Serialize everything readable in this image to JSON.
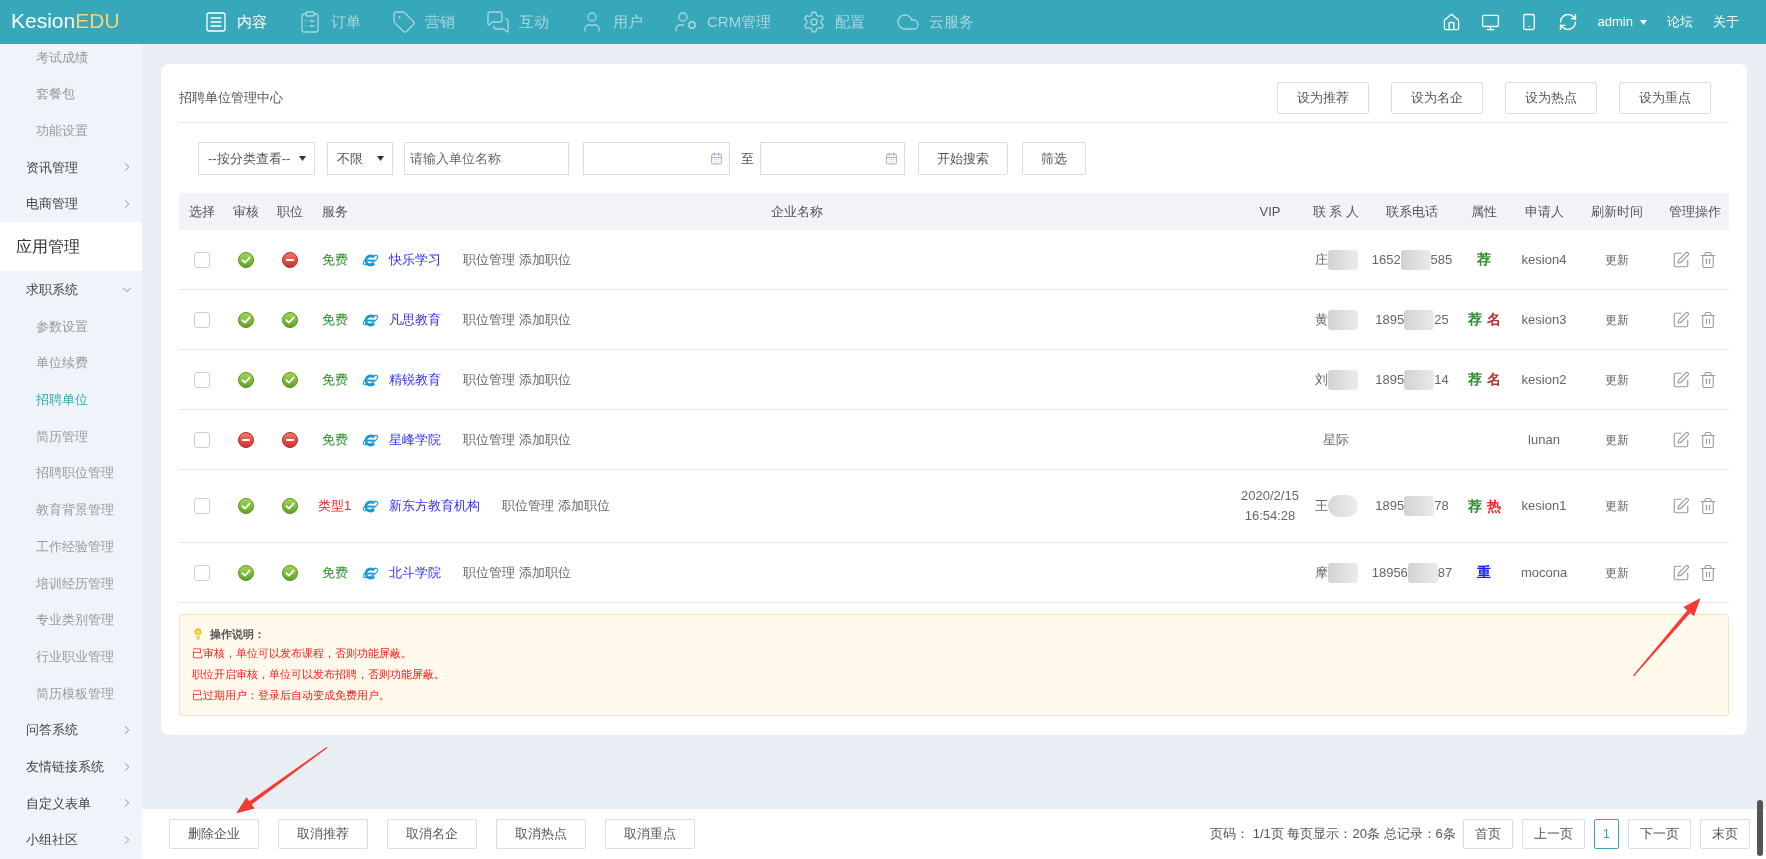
{
  "top_bar": {
    "logo": {
      "part_1": "Kesion",
      "part_2": "EDU"
    },
    "nav": [
      {
        "label": "内容",
        "selected": true
      },
      {
        "label": "订单",
        "selected": false
      },
      {
        "label": "营销",
        "selected": false
      },
      {
        "label": "互动",
        "selected": false
      },
      {
        "label": "用户",
        "selected": false
      },
      {
        "label": "CRM管理",
        "selected": false
      },
      {
        "label": "配置",
        "selected": false
      },
      {
        "label": "云服务",
        "selected": false
      }
    ],
    "user": "admin",
    "links": [
      "论坛",
      "关于"
    ]
  },
  "sidebar": {
    "sections": [
      {
        "items": [
          {
            "children": [
              {
                "label": "考试成绩",
                "selected": false
              },
              {
                "label": "套餐包",
                "selected": false
              },
              {
                "label": "功能设置",
                "selected": false
              }
            ]
          },
          {
            "label": "资讯管理",
            "expanded": false
          },
          {
            "label": "电商管理",
            "expanded": false
          }
        ]
      },
      {
        "title": "应用管理",
        "items": [
          {
            "label": "求职系统",
            "expanded": true,
            "children": [
              {
                "label": "参数设置",
                "selected": false
              },
              {
                "label": "单位续费",
                "selected": false
              },
              {
                "label": "招聘单位",
                "selected": true
              },
              {
                "label": "简历管理",
                "selected": false
              },
              {
                "label": "招聘职位管理",
                "selected": false
              },
              {
                "label": "教育背景管理",
                "selected": false
              },
              {
                "label": "工作经验管理",
                "selected": false
              },
              {
                "label": "培训经历管理",
                "selected": false
              },
              {
                "label": "专业类别管理",
                "selected": false
              },
              {
                "label": "行业职业管理",
                "selected": false
              },
              {
                "label": "简历模板管理",
                "selected": false
              }
            ]
          },
          {
            "label": "问答系统",
            "expanded": false
          },
          {
            "label": "友情链接系统",
            "expanded": false
          },
          {
            "label": "自定义表单",
            "expanded": false
          },
          {
            "label": "小组社区",
            "expanded": false
          }
        ]
      }
    ]
  },
  "panel": {
    "title": "招聘单位管理中心",
    "actions": [
      "设为推荐",
      "设为名企",
      "设为热点",
      "设为重点"
    ],
    "filters": {
      "category": "--按分类查看--",
      "scope": "不限",
      "name_search": {
        "placeholder": "请输入单位名称"
      },
      "range_separator": "至",
      "buttons": [
        "开始搜索",
        "筛选"
      ]
    },
    "table": {
      "columns": [
        "选择",
        "审核",
        "职位",
        "服务",
        "企业名称",
        "VIP",
        "联 系 人",
        "联系电话",
        "属性",
        "申请人",
        "刷新时间",
        "管理操作"
      ],
      "rows": [
        {
          "selected": false,
          "audited": true,
          "job_open": false,
          "service": {
            "label": "免费",
            "color": "#2c8f2c"
          },
          "company": "快乐学习",
          "links": [
            "职位管理",
            "添加职位"
          ],
          "contact": {
            "text": "庄",
            "redacted": true
          },
          "phone": {
            "start": "1652",
            "end": "585",
            "redacted": true
          },
          "attributes": [
            {
              "label": "荐",
              "color": "#2c8f2c"
            }
          ],
          "applicant": "kesion4",
          "refresh": "更新"
        },
        {
          "selected": false,
          "audited": true,
          "job_open": true,
          "service": {
            "label": "免费",
            "color": "#2c8f2c"
          },
          "company": "凡思教育",
          "links": [
            "职位管理",
            "添加职位"
          ],
          "contact": {
            "text": "黄",
            "redacted": true
          },
          "phone": {
            "start": "1895",
            "end": "25",
            "redacted": true
          },
          "attributes": [
            {
              "label": "荐",
              "color": "#2c8f2c"
            },
            {
              "label": "名",
              "color": "#b83232"
            }
          ],
          "applicant": "kesion3",
          "refresh": "更新"
        },
        {
          "selected": false,
          "audited": true,
          "job_open": true,
          "service": {
            "label": "免费",
            "color": "#2c8f2c"
          },
          "company": "精锐教育",
          "links": [
            "职位管理",
            "添加职位"
          ],
          "contact": {
            "text": "刘",
            "redacted": true
          },
          "phone": {
            "start": "1895",
            "end": "14",
            "redacted": true
          },
          "attributes": [
            {
              "label": "荐",
              "color": "#2c8f2c"
            },
            {
              "label": "名",
              "color": "#b83232"
            }
          ],
          "applicant": "kesion2",
          "refresh": "更新"
        },
        {
          "selected": false,
          "audited": false,
          "job_open": false,
          "service": {
            "label": "免费",
            "color": "#2c8f2c"
          },
          "company": "星峰学院",
          "links": [
            "职位管理",
            "添加职位"
          ],
          "contact": {
            "text": "星际",
            "redacted": false
          },
          "applicant": "lunan",
          "refresh": "更新"
        },
        {
          "selected": false,
          "audited": true,
          "job_open": true,
          "service": {
            "label": "类型1",
            "color": "#ff2020"
          },
          "company": "新东方教育机构",
          "links": [
            "职位管理",
            "添加职位"
          ],
          "vip": "2020/2/15 16:54:28",
          "contact": {
            "text": "王",
            "redacted": true
          },
          "phone": {
            "start": "1895",
            "end": "78",
            "redacted": true
          },
          "attributes": [
            {
              "label": "荐",
              "color": "#2c8f2c"
            },
            {
              "label": "热",
              "color": "#ff2020"
            }
          ],
          "applicant": "kesion1",
          "refresh": "更新"
        },
        {
          "selected": false,
          "audited": true,
          "job_open": true,
          "service": {
            "label": "免费",
            "color": "#2c8f2c"
          },
          "company": "北斗学院",
          "links": [
            "职位管理",
            "添加职位"
          ],
          "contact": {
            "text": "摩",
            "redacted": true
          },
          "phone": {
            "start": "18956",
            "end": "87",
            "redacted": true
          },
          "attributes": [
            {
              "label": "重",
              "color": "#1a1aff"
            }
          ],
          "applicant": "mocona",
          "refresh": "更新"
        }
      ]
    },
    "notes": {
      "title": "操作说明：",
      "lines": [
        "已审核，单位可以发布课程，否则功能屏蔽。",
        "职位开启审核，单位可以发布招聘，否则功能屏蔽。",
        "已过期用户：登录后自动变成免费用户。"
      ]
    }
  },
  "bottom_bar": {
    "actions": [
      "删除企业",
      "取消推荐",
      "取消名企",
      "取消热点",
      "取消重点"
    ],
    "pagination": {
      "summary": "页码： 1/1页 每页显示：20条 总记录：6条",
      "pages": [
        {
          "label": "首页",
          "selected": false
        },
        {
          "label": "上一页",
          "selected": false
        },
        {
          "label": "1",
          "selected": true
        },
        {
          "label": "下一页",
          "selected": false
        },
        {
          "label": "末页",
          "selected": false
        }
      ]
    }
  }
}
